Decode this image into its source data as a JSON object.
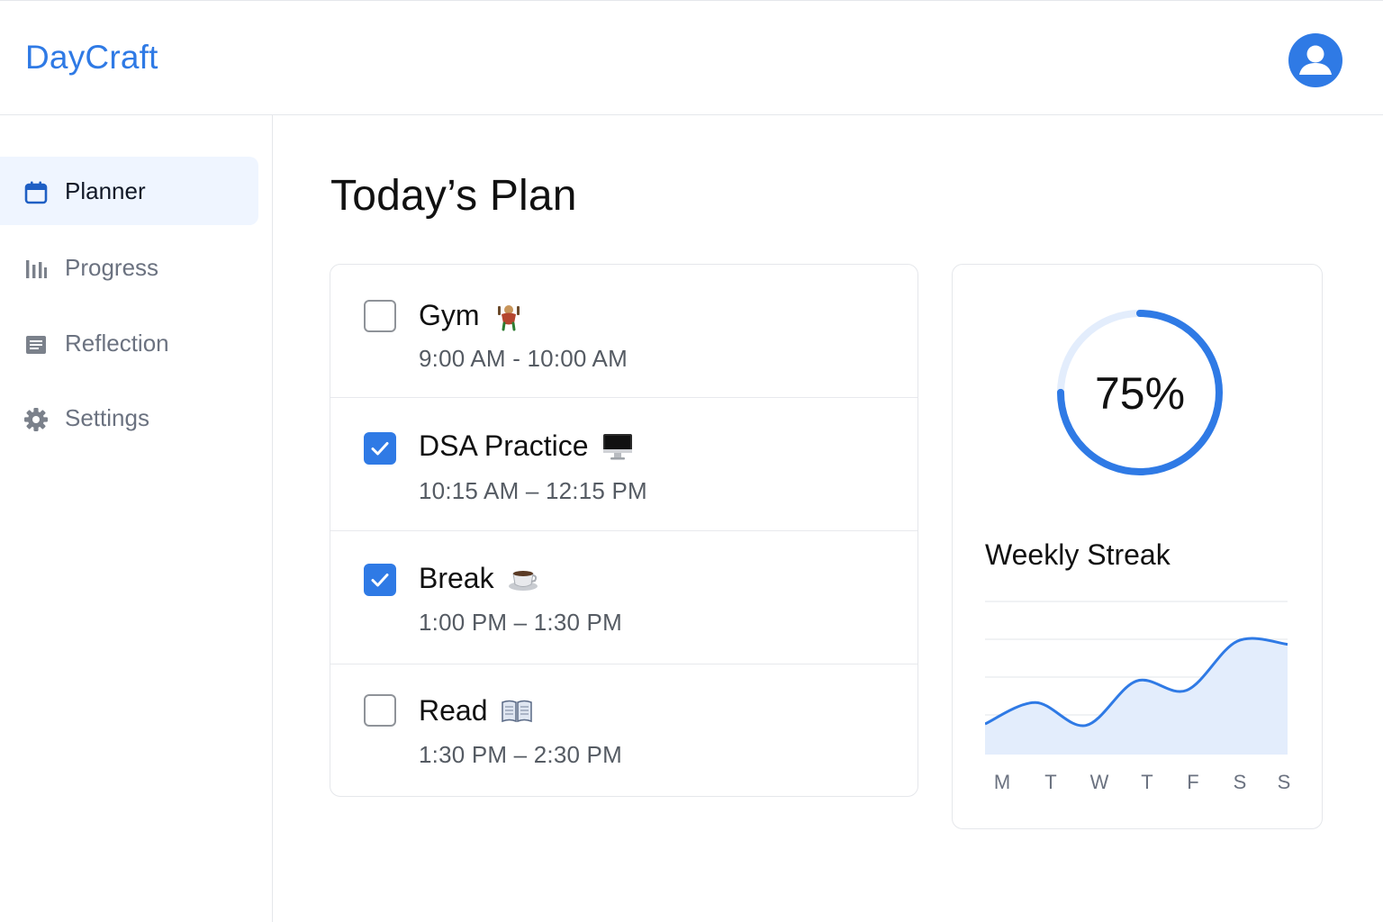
{
  "app": {
    "brand": "DayCraft",
    "accent_color": "#2f7ae5",
    "avatar_icon": "user-avatar-icon"
  },
  "sidebar": {
    "items": [
      {
        "label": "Planner",
        "icon": "calendar-icon",
        "active": true
      },
      {
        "label": "Progress",
        "icon": "bar-chart-icon",
        "active": false
      },
      {
        "label": "Reflection",
        "icon": "document-icon",
        "active": false
      },
      {
        "label": "Settings",
        "icon": "gear-icon",
        "active": false
      }
    ]
  },
  "main": {
    "title": "Today’s Plan",
    "tasks": [
      {
        "title": "Gym",
        "emoji": "weightlifter-icon",
        "time": "9:00 AM - 10:00 AM",
        "done": false
      },
      {
        "title": "DSA Practice",
        "emoji": "computer-icon",
        "time": "10:15 AM – 12:15 PM",
        "done": true
      },
      {
        "title": "Break",
        "emoji": "coffee-icon",
        "time": "1:00 PM – 1:30 PM",
        "done": true
      },
      {
        "title": "Read",
        "emoji": "book-icon",
        "time": "1:30 PM – 2:30 PM",
        "done": false
      }
    ]
  },
  "stats": {
    "completion_label": "75%",
    "completion_fraction": 0.75,
    "streak_title": "Weekly Streak"
  },
  "chart_data": {
    "type": "area",
    "categories": [
      "M",
      "T",
      "W",
      "T",
      "F",
      "S",
      "S"
    ],
    "values": [
      1.0,
      1.7,
      0.95,
      2.4,
      2.1,
      3.7,
      3.6
    ],
    "title": "Weekly Streak",
    "ylim": [
      0,
      5
    ],
    "grid": true,
    "color": "#2f7ae5",
    "fill_color": "#e3edfc"
  }
}
